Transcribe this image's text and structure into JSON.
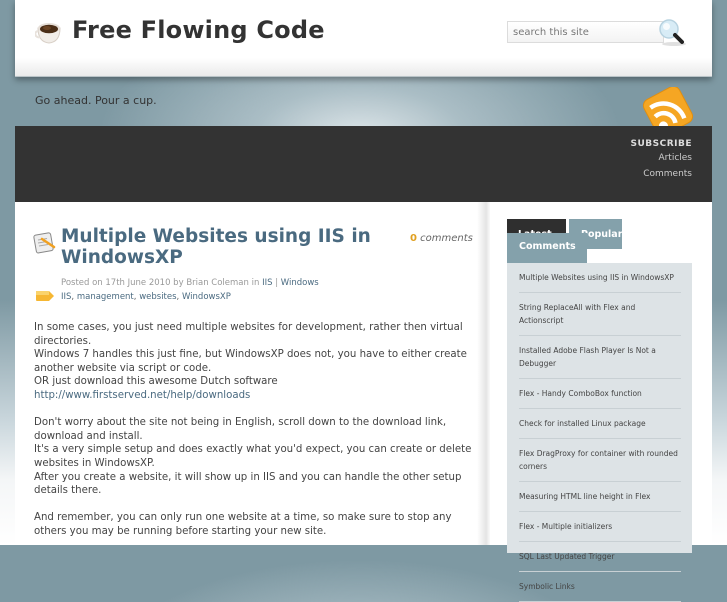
{
  "header": {
    "site_title": "Free Flowing Code",
    "tagline": "Go ahead. Pour a cup.",
    "search": {
      "placeholder": "search this site",
      "value": ""
    },
    "logo_icon": "coffee-cup-icon",
    "search_icon": "magnifier-icon"
  },
  "subscribe": {
    "title": "SUBSCRIBE",
    "links": [
      "Articles",
      "Comments"
    ],
    "icon": "rss-icon"
  },
  "post": {
    "title": "Multiple Websites using IIS in WindowsXP",
    "comments_count": "0",
    "comments_label": "comments",
    "meta_prefix": "Posted on 17th June 2010 by Brian Coleman in",
    "categories": [
      "IIS",
      "Windows"
    ],
    "category_separator": "|",
    "tags": [
      "IIS",
      "management",
      "websites",
      "WindowsXP"
    ],
    "paragraphs": [
      {
        "lines": [
          "In some cases, you just need multiple websites for development, rather then virtual directories.",
          "Windows 7 handles this just fine, but WindowsXP does not, you have to either create another website via script or code.",
          "OR just download this awesome Dutch software "
        ],
        "link": "http://www.firstserved.net/help/downloads"
      },
      {
        "lines": [
          "Don't worry about the site not being in English, scroll down to the download link, download and install.",
          "It's a very simple setup and does exactly what you'd expect, you can create or delete websites in WindowsXP.",
          "After you create a website, it will show up in IIS and you can handle the other setup details there."
        ]
      },
      {
        "lines": [
          "And remember, you can only run one website at a time, so make sure to stop any others you may be running before starting your new site."
        ]
      }
    ]
  },
  "sidebar": {
    "tabs": [
      {
        "label": "Latest",
        "active": false
      },
      {
        "label": "Popular",
        "active": true
      },
      {
        "label": "Comments",
        "active": false
      }
    ],
    "posts": [
      "Multiple Websites using IIS in WindowsXP",
      "String ReplaceAll with Flex and Actionscript",
      "Installed Adobe Flash Player Is Not a Debugger",
      "Flex - Handy ComboBox function",
      "Check for installed Linux package",
      "Flex DragProxy for container with rounded corners",
      "Measuring HTML line height in Flex",
      "Flex - Multiple initializers",
      "SQL Last Updated Trigger",
      "Symbolic Links"
    ]
  },
  "colors": {
    "accent_blue": "#4a6a80",
    "tab_active": "#84a1ab",
    "dark_bar": "#333333",
    "comment_count": "#e0a020",
    "rss_orange": "#f5a623"
  }
}
